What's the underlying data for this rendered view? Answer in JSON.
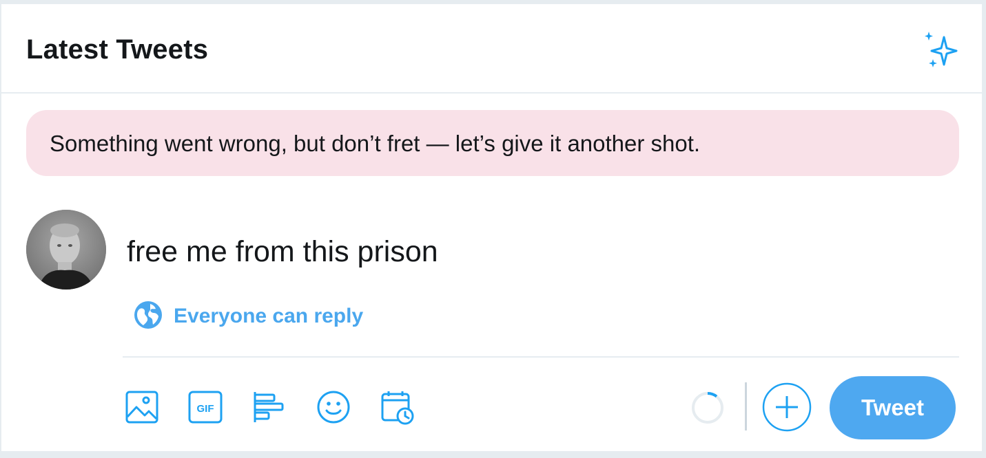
{
  "header": {
    "title": "Latest Tweets",
    "sparkle_icon": "sparkle-icon"
  },
  "error": {
    "message": "Something went wrong, but don’t fret — let’s give it another shot."
  },
  "compose": {
    "text": "free me from this prison",
    "reply_setting": "Everyone can reply",
    "reply_icon": "globe-icon",
    "tweet_label": "Tweet",
    "toolbar_icons": [
      "image-icon",
      "gif-icon",
      "poll-icon",
      "emoji-icon",
      "schedule-icon"
    ],
    "gif_label": "GIF",
    "add_icon": "plus-circle-icon"
  },
  "colors": {
    "accent": "#1da1f2",
    "tweet_button": "#4ea8f0",
    "error_bg": "#f9e1e8",
    "text": "#14171a",
    "border": "#e6ecf0"
  }
}
